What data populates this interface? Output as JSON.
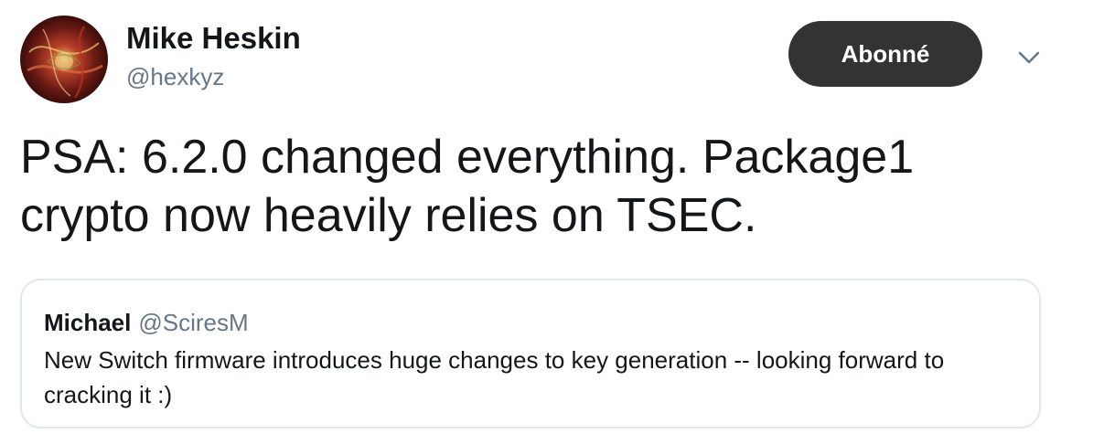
{
  "author": {
    "display_name": "Mike Heskin",
    "handle": "@hexkyz",
    "avatar_icon": "avatar-image"
  },
  "follow_button": {
    "label": "Abonné",
    "background": "#333333"
  },
  "menu": {
    "icon": "chevron-down-icon"
  },
  "tweet": {
    "text": "PSA: 6.2.0 changed everything. Package1 crypto now heavily relies on TSEC."
  },
  "quoted_tweet": {
    "display_name": "Michael",
    "handle": "@SciresM",
    "text": "New Switch firmware introduces huge changes to key generation -- looking forward to cracking it :)"
  },
  "colors": {
    "text": "#14171a",
    "secondary_text": "#657786",
    "border": "#e1e8ed"
  }
}
